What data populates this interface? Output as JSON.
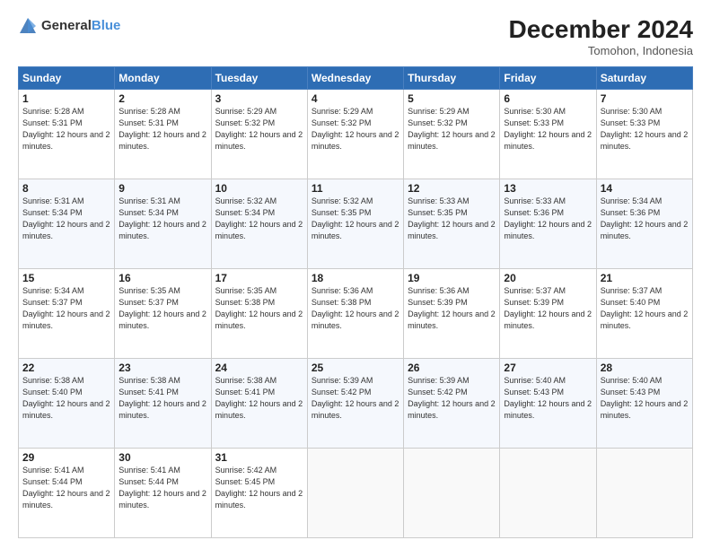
{
  "header": {
    "logo_general": "General",
    "logo_blue": "Blue",
    "title": "December 2024",
    "subtitle": "Tomohon, Indonesia"
  },
  "days_of_week": [
    "Sunday",
    "Monday",
    "Tuesday",
    "Wednesday",
    "Thursday",
    "Friday",
    "Saturday"
  ],
  "weeks": [
    [
      {
        "day": "1",
        "sunrise": "5:28 AM",
        "sunset": "5:31 PM",
        "daylight": "12 hours and 2 minutes."
      },
      {
        "day": "2",
        "sunrise": "5:28 AM",
        "sunset": "5:31 PM",
        "daylight": "12 hours and 2 minutes."
      },
      {
        "day": "3",
        "sunrise": "5:29 AM",
        "sunset": "5:32 PM",
        "daylight": "12 hours and 2 minutes."
      },
      {
        "day": "4",
        "sunrise": "5:29 AM",
        "sunset": "5:32 PM",
        "daylight": "12 hours and 2 minutes."
      },
      {
        "day": "5",
        "sunrise": "5:29 AM",
        "sunset": "5:32 PM",
        "daylight": "12 hours and 2 minutes."
      },
      {
        "day": "6",
        "sunrise": "5:30 AM",
        "sunset": "5:33 PM",
        "daylight": "12 hours and 2 minutes."
      },
      {
        "day": "7",
        "sunrise": "5:30 AM",
        "sunset": "5:33 PM",
        "daylight": "12 hours and 2 minutes."
      }
    ],
    [
      {
        "day": "8",
        "sunrise": "5:31 AM",
        "sunset": "5:34 PM",
        "daylight": "12 hours and 2 minutes."
      },
      {
        "day": "9",
        "sunrise": "5:31 AM",
        "sunset": "5:34 PM",
        "daylight": "12 hours and 2 minutes."
      },
      {
        "day": "10",
        "sunrise": "5:32 AM",
        "sunset": "5:34 PM",
        "daylight": "12 hours and 2 minutes."
      },
      {
        "day": "11",
        "sunrise": "5:32 AM",
        "sunset": "5:35 PM",
        "daylight": "12 hours and 2 minutes."
      },
      {
        "day": "12",
        "sunrise": "5:33 AM",
        "sunset": "5:35 PM",
        "daylight": "12 hours and 2 minutes."
      },
      {
        "day": "13",
        "sunrise": "5:33 AM",
        "sunset": "5:36 PM",
        "daylight": "12 hours and 2 minutes."
      },
      {
        "day": "14",
        "sunrise": "5:34 AM",
        "sunset": "5:36 PM",
        "daylight": "12 hours and 2 minutes."
      }
    ],
    [
      {
        "day": "15",
        "sunrise": "5:34 AM",
        "sunset": "5:37 PM",
        "daylight": "12 hours and 2 minutes."
      },
      {
        "day": "16",
        "sunrise": "5:35 AM",
        "sunset": "5:37 PM",
        "daylight": "12 hours and 2 minutes."
      },
      {
        "day": "17",
        "sunrise": "5:35 AM",
        "sunset": "5:38 PM",
        "daylight": "12 hours and 2 minutes."
      },
      {
        "day": "18",
        "sunrise": "5:36 AM",
        "sunset": "5:38 PM",
        "daylight": "12 hours and 2 minutes."
      },
      {
        "day": "19",
        "sunrise": "5:36 AM",
        "sunset": "5:39 PM",
        "daylight": "12 hours and 2 minutes."
      },
      {
        "day": "20",
        "sunrise": "5:37 AM",
        "sunset": "5:39 PM",
        "daylight": "12 hours and 2 minutes."
      },
      {
        "day": "21",
        "sunrise": "5:37 AM",
        "sunset": "5:40 PM",
        "daylight": "12 hours and 2 minutes."
      }
    ],
    [
      {
        "day": "22",
        "sunrise": "5:38 AM",
        "sunset": "5:40 PM",
        "daylight": "12 hours and 2 minutes."
      },
      {
        "day": "23",
        "sunrise": "5:38 AM",
        "sunset": "5:41 PM",
        "daylight": "12 hours and 2 minutes."
      },
      {
        "day": "24",
        "sunrise": "5:38 AM",
        "sunset": "5:41 PM",
        "daylight": "12 hours and 2 minutes."
      },
      {
        "day": "25",
        "sunrise": "5:39 AM",
        "sunset": "5:42 PM",
        "daylight": "12 hours and 2 minutes."
      },
      {
        "day": "26",
        "sunrise": "5:39 AM",
        "sunset": "5:42 PM",
        "daylight": "12 hours and 2 minutes."
      },
      {
        "day": "27",
        "sunrise": "5:40 AM",
        "sunset": "5:43 PM",
        "daylight": "12 hours and 2 minutes."
      },
      {
        "day": "28",
        "sunrise": "5:40 AM",
        "sunset": "5:43 PM",
        "daylight": "12 hours and 2 minutes."
      }
    ],
    [
      {
        "day": "29",
        "sunrise": "5:41 AM",
        "sunset": "5:44 PM",
        "daylight": "12 hours and 2 minutes."
      },
      {
        "day": "30",
        "sunrise": "5:41 AM",
        "sunset": "5:44 PM",
        "daylight": "12 hours and 2 minutes."
      },
      {
        "day": "31",
        "sunrise": "5:42 AM",
        "sunset": "5:45 PM",
        "daylight": "12 hours and 2 minutes."
      },
      null,
      null,
      null,
      null
    ]
  ],
  "labels": {
    "sunrise_prefix": "Sunrise: ",
    "sunset_prefix": "Sunset: ",
    "daylight_prefix": "Daylight: "
  }
}
